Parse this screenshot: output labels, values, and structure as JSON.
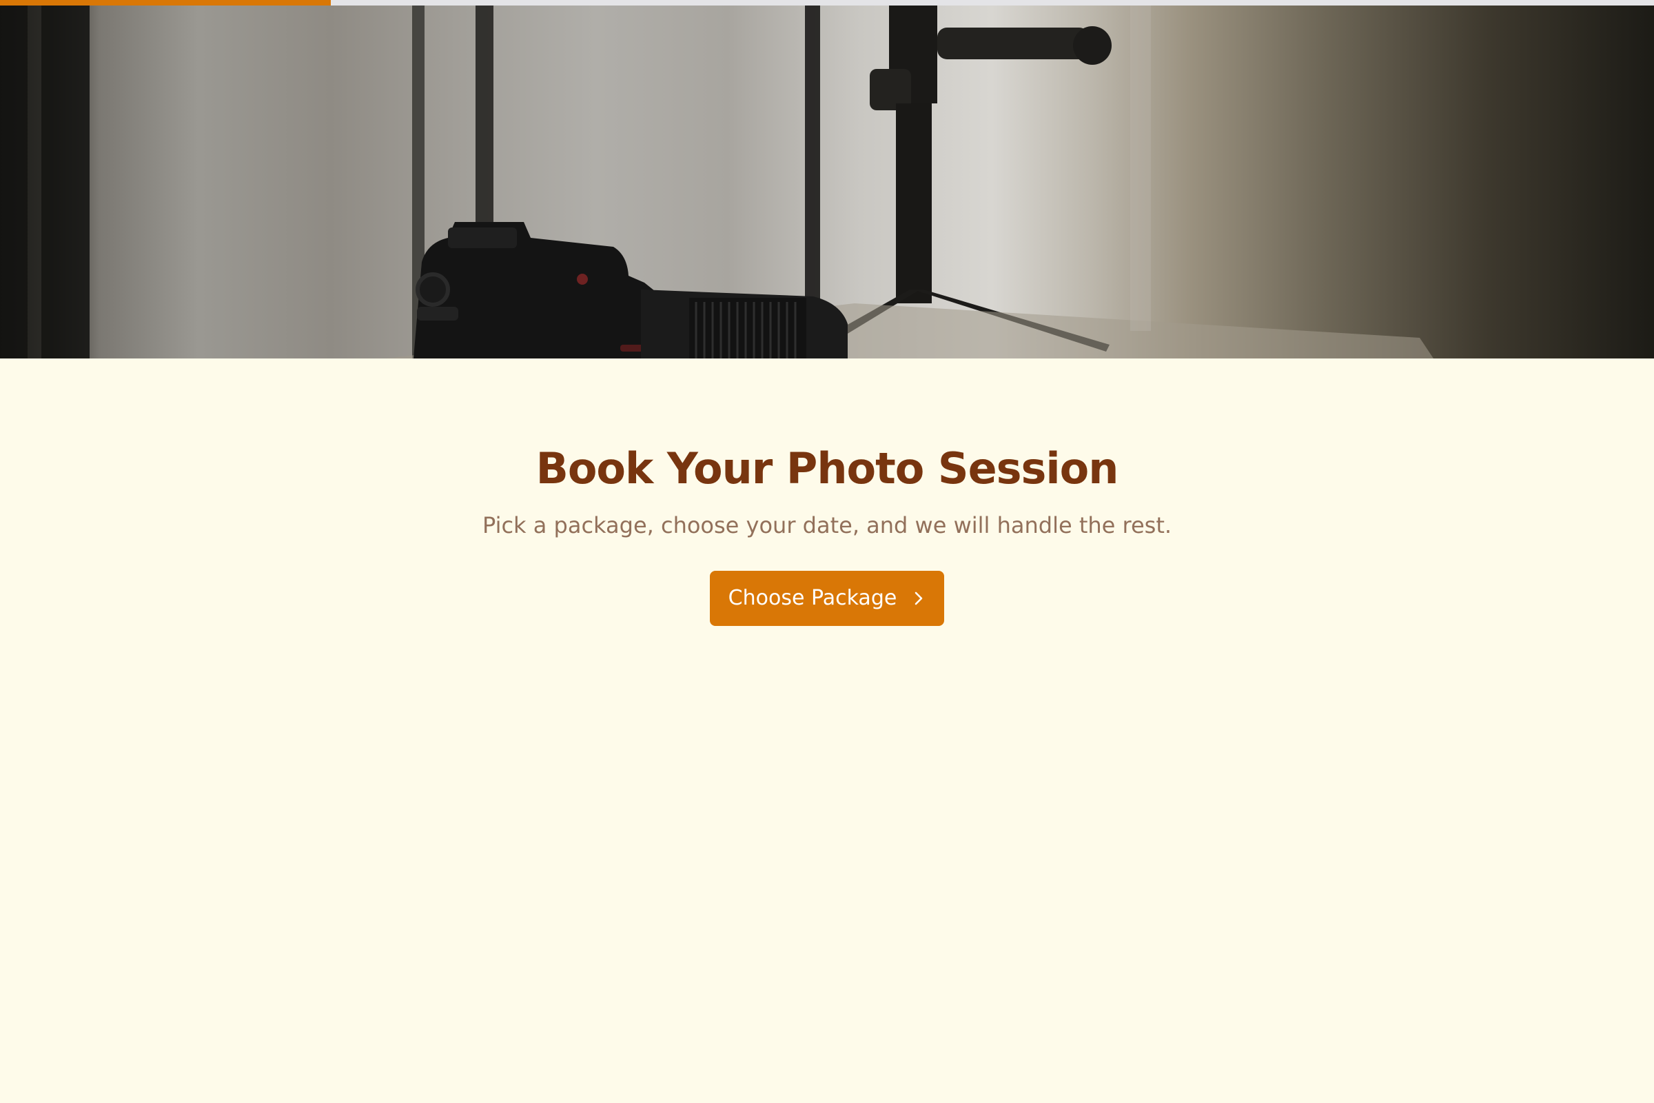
{
  "progress": {
    "value_percent": 20,
    "fill_color": "#d97706",
    "track_color": "#e4e4e7"
  },
  "hero": {
    "image_subject": "camera-on-table-with-tripod-light-stand"
  },
  "main": {
    "title": "Book Your Photo Session",
    "subtitle": "Pick a package, choose your date, and we will handle the rest.",
    "cta_label": "Choose Package",
    "cta_icon": "chevron-right-icon"
  },
  "colors": {
    "background": "#fefbea",
    "title": "#78350f",
    "subtitle": "#92705a",
    "accent": "#d97706"
  }
}
